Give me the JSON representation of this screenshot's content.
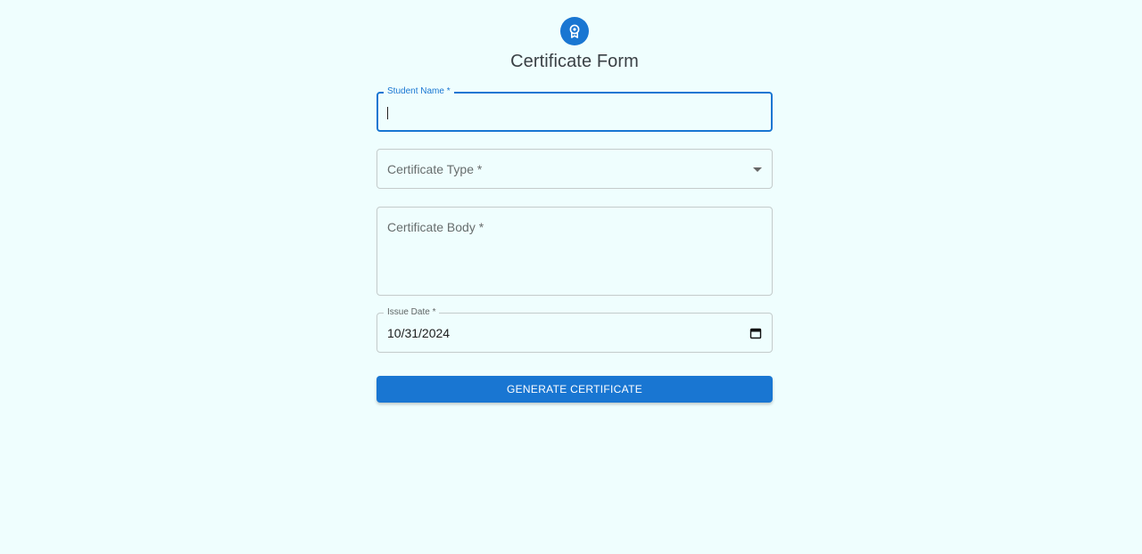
{
  "form": {
    "icon": "award-icon",
    "title": "Certificate Form",
    "student_name_label": "Student Name *",
    "student_name_value": "",
    "certificate_type_label": "Certificate Type *",
    "certificate_body_label": "Certificate Body *",
    "issue_date_label": "Issue Date *",
    "issue_date_value": "10/31/2024",
    "submit_label": "GENERATE CERTIFICATE"
  },
  "colors": {
    "background": "#effefe",
    "primary": "#1976d2",
    "border": "#c4cbcb"
  }
}
